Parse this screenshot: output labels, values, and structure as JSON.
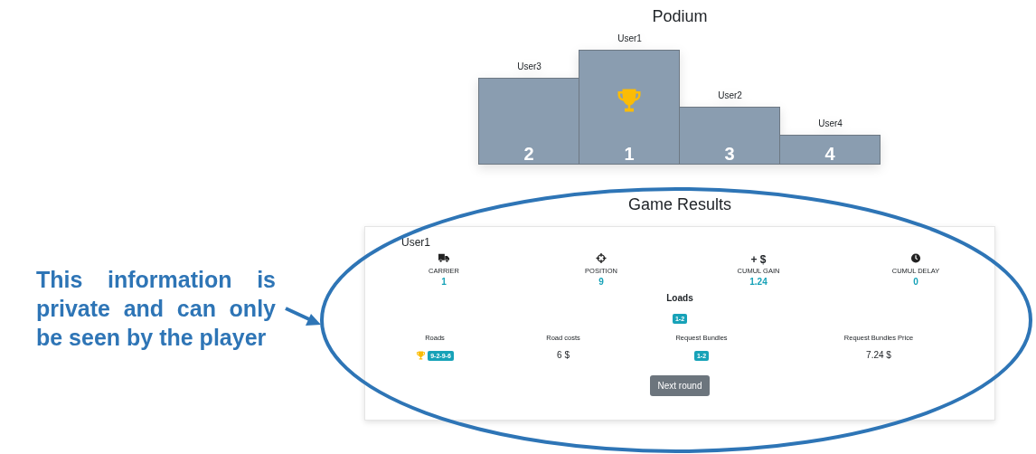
{
  "podium": {
    "title": "Podium",
    "places": [
      {
        "name": "User3",
        "rank": "2",
        "trophy": false
      },
      {
        "name": "User1",
        "rank": "1",
        "trophy": true
      },
      {
        "name": "User2",
        "rank": "3",
        "trophy": false
      },
      {
        "name": "User4",
        "rank": "4",
        "trophy": false
      }
    ]
  },
  "results": {
    "title": "Game Results",
    "player": "User1",
    "stats": [
      {
        "kind": "truck",
        "label": "CARRIER",
        "value": "1"
      },
      {
        "kind": "crosshair",
        "label": "POSITION",
        "value": "9"
      },
      {
        "kind": "symbol",
        "symbol": "+ $",
        "label": "CUMUL GAIN",
        "value": "1.24"
      },
      {
        "kind": "clock",
        "label": "CUMUL DELAY",
        "value": "0"
      }
    ],
    "loads": {
      "title": "Loads",
      "badges": [
        "1-2"
      ]
    },
    "details": [
      {
        "kind": "badge",
        "label": "Roads",
        "trophy": true,
        "value": "9-2-9-6"
      },
      {
        "kind": "text",
        "label": "Road costs",
        "value": "6 $"
      },
      {
        "kind": "badge",
        "label": "Request Bundles",
        "trophy": false,
        "value": "1-2"
      },
      {
        "kind": "text",
        "label": "Request Bundles Price",
        "value": "7.24 $"
      }
    ],
    "button": "Next round"
  },
  "annotation": {
    "text": "This information is private and can only be seen by the player"
  }
}
